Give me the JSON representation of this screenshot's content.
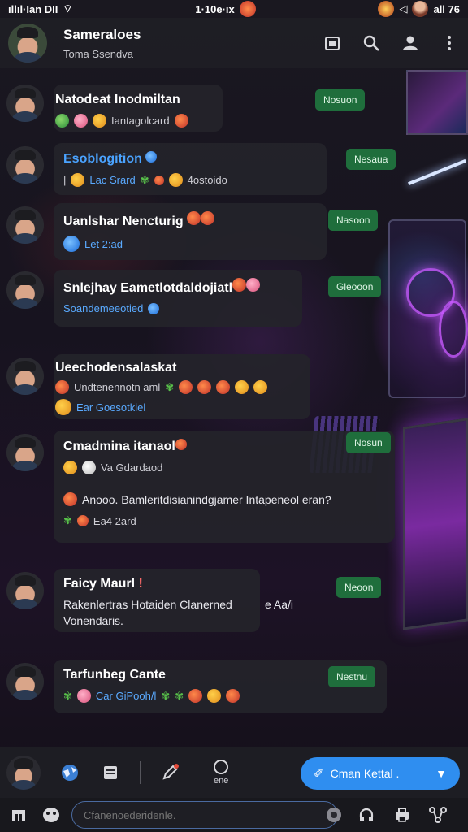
{
  "status_bar": {
    "left": "ıllıl·Ian DII",
    "center": "1·10e·ıx",
    "right": "all 76"
  },
  "header": {
    "title": "Sameraloes",
    "subtitle": "Toma Ssendva"
  },
  "chats": [
    {
      "name": "Natodeat Inodmiltan",
      "line1": "Iantagolcard",
      "tag": "Nosuon"
    },
    {
      "name": "Esoblogition",
      "line1": "Lac Srard",
      "line1_suffix": "4ostoido",
      "tag": "Nesaua"
    },
    {
      "name": "Uanlshar Nencturig",
      "line1": "Let 2:ad",
      "tag": "Nasoon"
    },
    {
      "name": "Snlejhay Eametlotdaldojiatl",
      "line1": "Soandemeeotied",
      "tag": "Gleooon"
    },
    {
      "name": "Ueechodensalaskat",
      "line1": "Undtenennotn aml",
      "line2": "Ear Goesotkiel"
    },
    {
      "name": "Cmadmina itanaol",
      "line1": "Va Gdardaod",
      "line2": "Anooo. Bamleritdisianindgjamer Intapeneol eran?",
      "line3": "Ea4 2ard",
      "tag": "Nosun"
    },
    {
      "name": "Faicy Maurl",
      "line1": "Rakenlertras Hotaiden Clanerned",
      "line1_suffix": "e Aa/i",
      "line2": "Vonendaris.",
      "tag": "Neoon"
    },
    {
      "name": "Tarfunbeg Cante",
      "line1": "Car GiPooh/l",
      "tag": "Nestnu"
    }
  ],
  "bottom_nav": {
    "item_label": "ene",
    "cta_label": "Cman Kettal ."
  },
  "compose": {
    "placeholder": "Cfanenoederidenle."
  },
  "colors": {
    "tag_bg": "#1f6e3c",
    "cta_bg": "#2f8ef0",
    "accent_blue": "#4aa3ff"
  }
}
